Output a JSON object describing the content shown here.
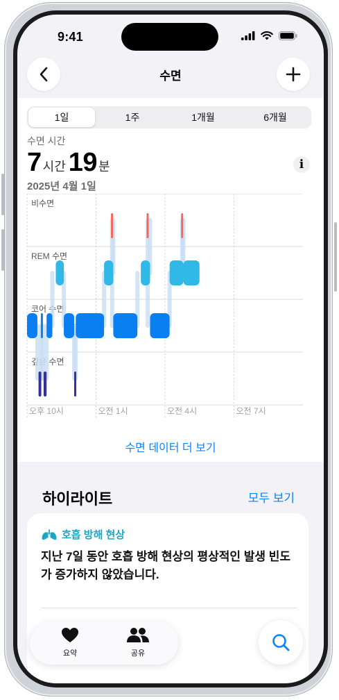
{
  "status": {
    "time": "9:41"
  },
  "nav": {
    "title": "수면",
    "back_icon": "chevron-left-icon",
    "add_icon": "plus-icon"
  },
  "segments": [
    {
      "label": "1일",
      "active": true
    },
    {
      "label": "1주",
      "active": false
    },
    {
      "label": "1개월",
      "active": false
    },
    {
      "label": "6개월",
      "active": false
    }
  ],
  "summary": {
    "label": "수면 시간",
    "hours": "7",
    "hours_unit": "시간",
    "minutes": "19",
    "minutes_unit": "분",
    "date": "2025년 4월 1일"
  },
  "chart_data": {
    "type": "timeline",
    "stages": [
      "비수면",
      "REM 수면",
      "코어 수면",
      "깊은 수면"
    ],
    "x_ticks": [
      "오후 10시",
      "오전 1시",
      "오전 4시",
      "오전 7시"
    ],
    "x_range_hours": [
      22,
      34
    ],
    "colors": {
      "awake": "#f36a5a",
      "rem": "#30b8e6",
      "core": "#0a7ff2",
      "deep": "#36309c"
    },
    "segments": [
      {
        "stage": "코어 수면",
        "start": 22.0,
        "end": 22.45
      },
      {
        "stage": "깊은 수면",
        "start": 22.5,
        "end": 22.62
      },
      {
        "stage": "코어 수면",
        "start": 22.6,
        "end": 22.68
      },
      {
        "stage": "깊은 수면",
        "start": 22.72,
        "end": 22.85
      },
      {
        "stage": "코어 수면",
        "start": 22.85,
        "end": 23.1
      },
      {
        "stage": "REM 수면",
        "start": 23.25,
        "end": 23.6
      },
      {
        "stage": "코어 수면",
        "start": 23.6,
        "end": 24.05
      },
      {
        "stage": "깊은 수면",
        "start": 24.05,
        "end": 24.12
      },
      {
        "stage": "코어 수면",
        "start": 24.12,
        "end": 25.35
      },
      {
        "stage": "비수면",
        "start": 25.65,
        "end": 25.7
      },
      {
        "stage": "REM 수면",
        "start": 25.35,
        "end": 25.75
      },
      {
        "stage": "코어 수면",
        "start": 25.75,
        "end": 26.8
      },
      {
        "stage": "비수면",
        "start": 27.2,
        "end": 27.25
      },
      {
        "stage": "REM 수면",
        "start": 26.95,
        "end": 27.35
      },
      {
        "stage": "코어 수면",
        "start": 27.35,
        "end": 28.2
      },
      {
        "stage": "REM 수면",
        "start": 28.2,
        "end": 28.8
      },
      {
        "stage": "비수면",
        "start": 28.7,
        "end": 28.75
      },
      {
        "stage": "REM 수면",
        "start": 28.8,
        "end": 29.5
      }
    ]
  },
  "more_link": "수면 데이터 더 보기",
  "highlights": {
    "title": "하이라이트",
    "see_all": "모두 보기",
    "card": {
      "icon": "lungs-icon",
      "category": "호흡 방해 현상",
      "body": "지난 7일 동안 호흡 방해 현상의 평상적인 발생 빈도가 증가하지 않았습니다."
    }
  },
  "tabs": [
    {
      "label": "요약",
      "icon": "heart-icon"
    },
    {
      "label": "공유",
      "icon": "people-icon"
    }
  ],
  "search_icon": "search-icon"
}
